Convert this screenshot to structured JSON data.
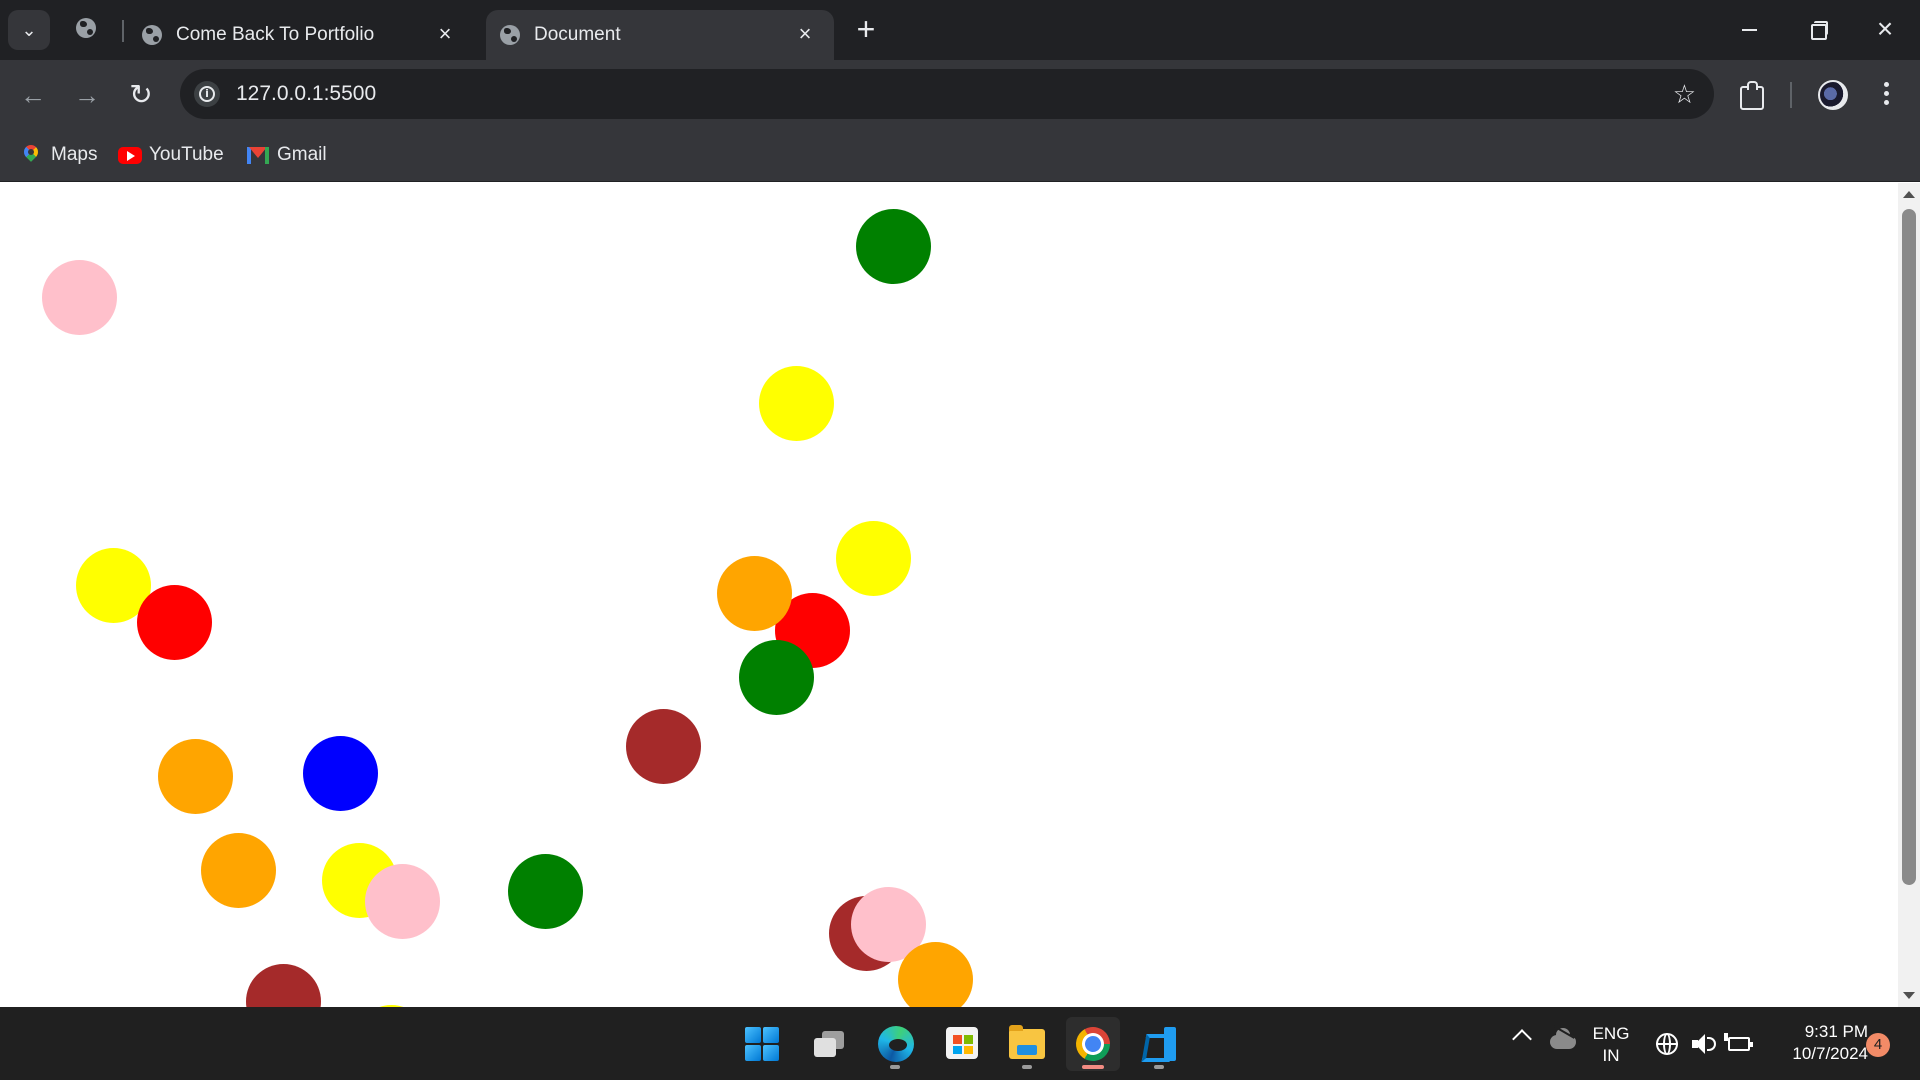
{
  "browser": {
    "tabs": [
      {
        "title": "Come Back To Portfolio",
        "active": false
      },
      {
        "title": "Document",
        "active": true
      }
    ],
    "address_bar": {
      "url": "127.0.0.1:5500"
    },
    "bookmarks": [
      {
        "label": "Maps",
        "icon": "google-maps-icon"
      },
      {
        "label": "YouTube",
        "icon": "youtube-icon"
      },
      {
        "label": "Gmail",
        "icon": "gmail-icon"
      }
    ]
  },
  "page": {
    "background": "#ffffff",
    "balls": [
      {
        "color": "pink"
      },
      {
        "color": "green"
      },
      {
        "color": "yellow"
      },
      {
        "color": "yellow"
      },
      {
        "color": "red"
      },
      {
        "color": "yellow"
      },
      {
        "color": "orange"
      },
      {
        "color": "red"
      },
      {
        "color": "green"
      },
      {
        "color": "brown"
      },
      {
        "color": "orange"
      },
      {
        "color": "blue"
      },
      {
        "color": "orange"
      },
      {
        "color": "yellow"
      },
      {
        "color": "pink"
      },
      {
        "color": "green"
      },
      {
        "color": "brown"
      },
      {
        "color": "pink"
      },
      {
        "color": "orange"
      },
      {
        "color": "brown"
      },
      {
        "color": "yellow"
      }
    ]
  },
  "taskbar": {
    "apps": [
      {
        "name": "start",
        "icon": "windows-start-icon"
      },
      {
        "name": "task-view",
        "icon": "task-view-icon"
      },
      {
        "name": "edge",
        "icon": "edge-icon"
      },
      {
        "name": "microsoft-store",
        "icon": "store-icon"
      },
      {
        "name": "file-explorer",
        "icon": "folder-icon"
      },
      {
        "name": "chrome",
        "icon": "chrome-icon",
        "active": true
      },
      {
        "name": "vscode",
        "icon": "vscode-icon"
      }
    ],
    "language": {
      "line1": "ENG",
      "line2": "IN"
    },
    "clock": {
      "time": "9:31 PM",
      "date": "10/7/2024"
    },
    "notification_count": "4"
  }
}
